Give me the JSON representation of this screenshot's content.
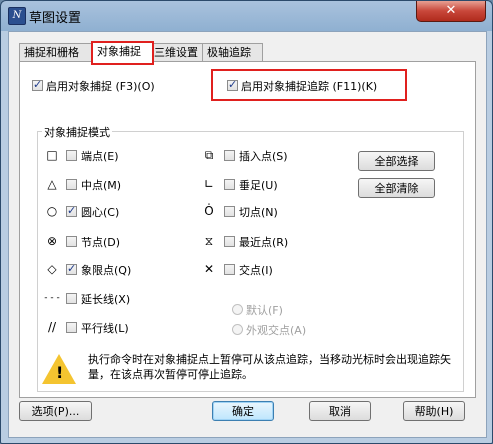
{
  "window": {
    "title": "草图设置",
    "close_glyph": "✕",
    "app_icon_glyph": "N"
  },
  "tabs": [
    {
      "label": "捕捉和栅格"
    },
    {
      "label": "对象捕捉"
    },
    {
      "label": "三维设置"
    },
    {
      "label": "极轴追踪"
    }
  ],
  "snap": {
    "enable_snap": {
      "label": "启用对象捕捉 (F3)(O)",
      "checked": true
    },
    "enable_tracking": {
      "label": "启用对象捕捉追踪 (F11)(K)",
      "checked": true
    },
    "modes_title": "对象捕捉模式",
    "modes_left": [
      {
        "symbol": "□",
        "icon": "square-icon",
        "label": "端点(E)",
        "checked": false
      },
      {
        "symbol": "△",
        "icon": "triangle-icon",
        "label": "中点(M)",
        "checked": false
      },
      {
        "symbol": "○",
        "icon": "circle-icon",
        "label": "圆心(C)",
        "checked": true
      },
      {
        "symbol": "⊗",
        "icon": "node-icon",
        "label": "节点(D)",
        "checked": false
      },
      {
        "symbol": "◇",
        "icon": "diamond-icon",
        "label": "象限点(Q)",
        "checked": true
      },
      {
        "symbol": "- - -",
        "icon": "extension-icon",
        "label": "延长线(X)",
        "checked": false
      },
      {
        "symbol": "//",
        "icon": "parallel-icon",
        "label": "平行线(L)",
        "checked": false
      }
    ],
    "modes_right": [
      {
        "symbol": "⧉",
        "icon": "insert-icon",
        "label": "插入点(S)",
        "checked": false
      },
      {
        "symbol": "∟",
        "icon": "perpendicular-icon",
        "label": "垂足(U)",
        "checked": false
      },
      {
        "symbol": "Ȯ",
        "icon": "tangent-icon",
        "label": "切点(N)",
        "checked": false
      },
      {
        "symbol": "⧖",
        "icon": "nearest-icon",
        "label": "最近点(R)",
        "checked": false
      },
      {
        "symbol": "✕",
        "icon": "intersection-icon",
        "label": "交点(I)",
        "checked": false
      }
    ],
    "select_all": "全部选择",
    "clear_all": "全部清除",
    "radio_default": "默认(F)",
    "radio_apparent": "外观交点(A)",
    "message": "执行命令时在对象捕捉点上暂停可从该点追踪，当移动光标时会出现追踪矢量，在该点再次暂停可停止追踪。"
  },
  "footer": {
    "options": "选项(P)...",
    "ok": "确定",
    "cancel": "取消",
    "help": "帮助(H)"
  }
}
